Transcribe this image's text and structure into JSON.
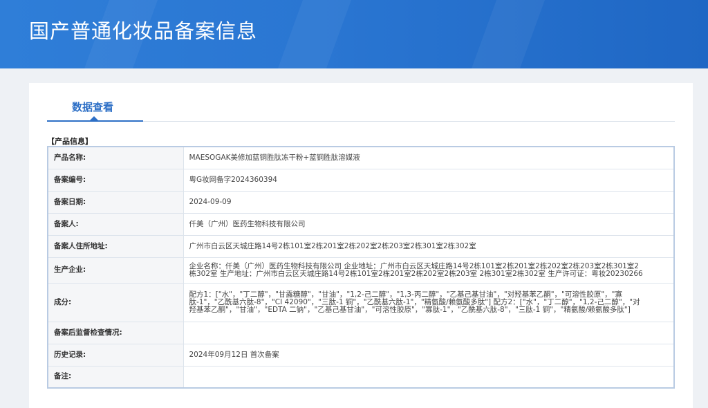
{
  "page": {
    "title": "国产普通化妆品备案信息"
  },
  "tabs": [
    {
      "label": "数据查看"
    }
  ],
  "section": {
    "label": "【产品信息】"
  },
  "rows": [
    {
      "label": "产品名称:",
      "value": "MAESOGAK美修加蓝铜胜肽冻干粉+蓝铜胜肽溶媒液"
    },
    {
      "label": "备案编号:",
      "value": "粤G妆网备字2024360394"
    },
    {
      "label": "备案日期:",
      "value": "2024-09-09"
    },
    {
      "label": "备案人:",
      "value": "仟美（广州）医药生物科技有限公司"
    },
    {
      "label": "备案人住所地址:",
      "value": "广州市白云区天城庄路14号2栋101室2栋201室2栋202室2栋203室2栋301室2栋302室"
    },
    {
      "label": "生产企业:",
      "value": "企业名称：仟美（广州）医药生物科技有限公司 企业地址：广州市白云区天城庄路14号2栋101室2栋201室2栋202室2栋203室2栋301室2栋302室 生产地址：广州市白云区天城庄路14号2栋101室2栋201室2栋202室2栋203室 2栋301室2栋302室 生产许可证：粤妆20230266"
    },
    {
      "label": "成分:",
      "value": "配方1：[\"水\"，\"丁二醇\"，\"甘露糖醇\"，\"甘油\"，\"1,2-己二醇\"，\"1,3-丙二醇\"，\"乙基己基甘油\"，\"对羟基苯乙酮\"，\"可溶性胶原\"，\"寡肽-1\"，\"乙酰基六肽-8\"，\"CI 42090\"，\"三肽-1 铜\"，\"乙酰基六肽-1\"，\"精氨酸/赖氨酸多肽\"] 配方2：[\"水\"，\"丁二醇\"，\"1,2-己二醇\"，\"对羟基苯乙酮\"，\"甘油\"，\"EDTA 二钠\"，\"乙基己基甘油\"，\"可溶性胶原\"，\"寡肽-1\"，\"乙酰基六肽-8\"，\"三肽-1 铜\"，\"精氨酸/赖氨酸多肽\"]"
    },
    {
      "label": "备案后监督检查情况:",
      "value": ""
    },
    {
      "label": "历史记录:",
      "value": "2024年09月12日 首次备案"
    },
    {
      "label": "备注:",
      "value": ""
    }
  ],
  "colors": {
    "banner": "#2a76d2",
    "accent": "#2d6fc6",
    "label_bg": "#f5f6f8",
    "table_border": "#b9cbe3"
  }
}
